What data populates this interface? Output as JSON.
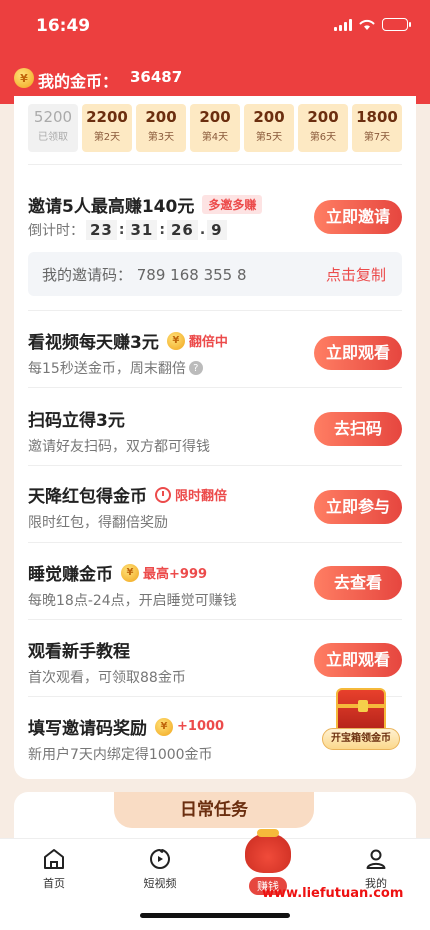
{
  "status_bar": {
    "time": "16:49"
  },
  "header": {
    "title": "我的金币：",
    "amount": "36487"
  },
  "checkin": {
    "days": [
      {
        "value": "5200",
        "label": "已领取",
        "claimed": true
      },
      {
        "value": "2200",
        "label": "第2天"
      },
      {
        "value": "200",
        "label": "第3天"
      },
      {
        "value": "200",
        "label": "第4天"
      },
      {
        "value": "200",
        "label": "第5天"
      },
      {
        "value": "200",
        "label": "第6天"
      },
      {
        "value": "1800",
        "label": "第7天"
      }
    ]
  },
  "invite": {
    "title": "邀请5人最高赚140元",
    "badge": "多邀多赚",
    "countdown_label": "倒计时：",
    "countdown": {
      "h": "23",
      "m": "31",
      "s": "26",
      "ms": "9"
    },
    "button": "立即邀请",
    "code_label": "我的邀请码：  789 168 355 8",
    "copy": "点击复制"
  },
  "tasks": [
    {
      "title": "看视频每天赚3元",
      "tag": "翻倍中",
      "tag_type": "coin",
      "subtitle": "每15秒送金币，周末翻倍",
      "help": "?",
      "button": "立即观看"
    },
    {
      "title": "扫码立得3元",
      "subtitle": "邀请好友扫码，双方都可得钱",
      "button": "去扫码"
    },
    {
      "title": "天降红包得金币",
      "tag": "限时翻倍",
      "tag_type": "clock",
      "subtitle": "限时红包，得翻倍奖励",
      "button": "立即参与"
    },
    {
      "title": "睡觉赚金币",
      "tag": "最高+999",
      "tag_type": "coin",
      "subtitle": "每晚18点-24点，开启睡觉可赚钱",
      "button": "去查看"
    },
    {
      "title": "观看新手教程",
      "subtitle": "首次观看，可领取88金币",
      "button": "立即观看"
    },
    {
      "title": "填写邀请码奖励",
      "tag": "+1000",
      "tag_type": "coin",
      "subtitle": "新用户7天内绑定得1000金币"
    }
  ],
  "chest": {
    "label": "开宝箱领金币"
  },
  "daily": {
    "title": "日常任务"
  },
  "tabbar": {
    "items": [
      {
        "label": "首页",
        "icon": "home-icon"
      },
      {
        "label": "短视频",
        "icon": "video-icon"
      },
      {
        "label": "赚钱",
        "icon": "money-bag-icon",
        "active": true
      },
      {
        "label": "我的",
        "icon": "profile-icon"
      }
    ]
  },
  "watermark": "www.liefutuan.com",
  "coin_glyph": "¥"
}
